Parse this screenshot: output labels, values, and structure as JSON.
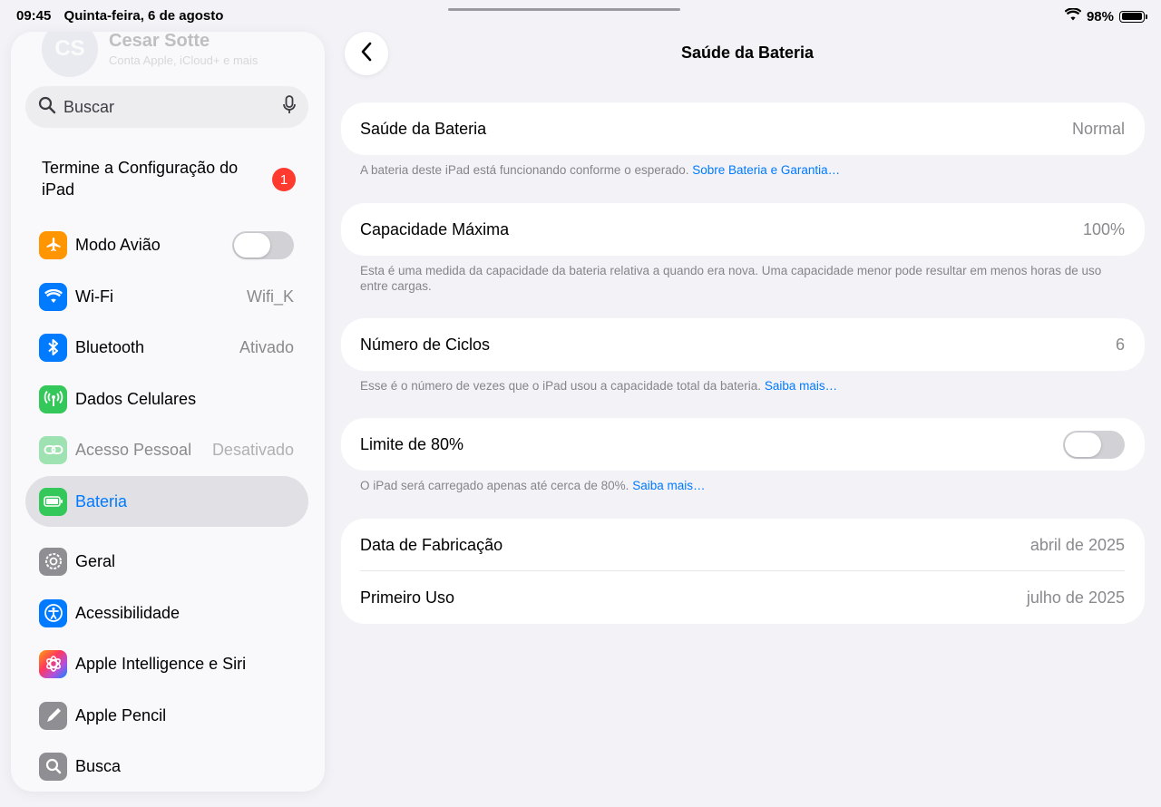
{
  "status_bar": {
    "time": "09:45",
    "date": "Quinta-feira, 6 de agosto",
    "battery_percent": "98%",
    "battery_level": 0.98
  },
  "sidebar": {
    "profile": {
      "initials": "CS",
      "name": "Cesar Sotte",
      "subtitle": "Conta Apple, iCloud+ e mais"
    },
    "search": {
      "placeholder": "Buscar",
      "icon": "magnifyingglass-icon",
      "mic_icon": "mic-icon"
    },
    "setup": {
      "label": "Termine a Configuração do iPad",
      "badge": "1"
    },
    "items": [
      {
        "label": "Modo Avião",
        "value": "",
        "toggle": false,
        "icon": "airplane-icon",
        "color": "#ff9500"
      },
      {
        "label": "Wi-Fi",
        "value": "Wifi_K",
        "icon": "wifi-icon",
        "color": "#007aff"
      },
      {
        "label": "Bluetooth",
        "value": "Ativado",
        "icon": "bluetooth-icon",
        "color": "#007aff"
      },
      {
        "label": "Dados Celulares",
        "value": "",
        "icon": "antenna-icon",
        "color": "#34c759"
      },
      {
        "label": "Acesso Pessoal",
        "value": "Desativado",
        "icon": "hotspot-icon",
        "color": "#34c759"
      },
      {
        "label": "Bateria",
        "value": "",
        "icon": "battery-icon",
        "color": "#34c759",
        "selected": true
      },
      {
        "label": "Geral",
        "value": "",
        "icon": "gear-icon",
        "color": "#8e8e93"
      },
      {
        "label": "Acessibilidade",
        "value": "",
        "icon": "accessibility-icon",
        "color": "#007aff"
      },
      {
        "label": "Apple Intelligence e Siri",
        "value": "",
        "icon": "siri-icon",
        "color": "#af52de"
      },
      {
        "label": "Apple Pencil",
        "value": "",
        "icon": "pencil-icon",
        "color": "#8e8e93"
      },
      {
        "label": "Busca",
        "value": "",
        "icon": "search-icon",
        "color": "#8e8e93"
      }
    ]
  },
  "main": {
    "title": "Saúde da Bateria",
    "health": {
      "label": "Saúde da Bateria",
      "value": "Normal",
      "footnote": "A bateria deste iPad está funcionando conforme o esperado.",
      "link": "Sobre Bateria e Garantia…"
    },
    "capacity": {
      "label": "Capacidade Máxima",
      "value": "100%",
      "footnote": "Esta é uma medida da capacidade da bateria relativa a quando era nova. Uma capacidade menor pode resultar em menos horas de uso entre cargas."
    },
    "cycles": {
      "label": "Número de Ciclos",
      "value": "6",
      "footnote": "Esse é o número de vezes que o iPad usou a capacidade total da bateria.",
      "link": "Saiba mais…"
    },
    "limit": {
      "label": "Limite de 80%",
      "toggle": false,
      "footnote": "O iPad será carregado apenas até cerca de 80%.",
      "link": "Saiba mais…"
    },
    "dates": {
      "manufacture_label": "Data de Fabricação",
      "manufacture_value": "abril de 2025",
      "first_use_label": "Primeiro Uso",
      "first_use_value": "julho de 2025"
    }
  }
}
